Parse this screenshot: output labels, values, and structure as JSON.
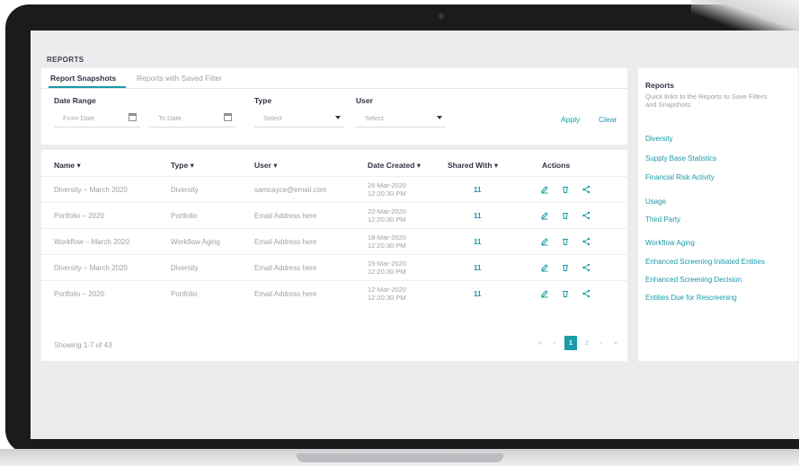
{
  "section_title": "REPORTS",
  "tabs": [
    {
      "label": "Report Snapshots",
      "active": true
    },
    {
      "label": "Reports with Saved Filter",
      "active": false
    }
  ],
  "filters": {
    "date_range_label": "Date Range",
    "from_date_placeholder": "From Date",
    "to_date_placeholder": "To Date",
    "type_label": "Type",
    "type_value": "Select",
    "user_label": "User",
    "user_value": "Select",
    "apply_label": "Apply",
    "clear_label": "Clear"
  },
  "table": {
    "headers": {
      "name": "Name ▾",
      "type": "Type ▾",
      "user": "User ▾",
      "date_created": "Date Created ▾",
      "shared_with": "Shared With ▾",
      "actions": "Actions"
    },
    "rows": [
      {
        "name": "Diversity – March 2020",
        "type": "Diversity",
        "user": "samcayce@email.com",
        "date": "26-Mar-2020",
        "time": "12:20:30 PM",
        "shared": "11"
      },
      {
        "name": "Portfolio – 2020",
        "type": "Portfolio",
        "user": "Email Address here",
        "date": "22-Mar-2020",
        "time": "12:20:30 PM",
        "shared": "11"
      },
      {
        "name": "Workflow – March 2020",
        "type": "Workflow Aging",
        "user": "Email Address here",
        "date": "18-Mar-2020",
        "time": "12:20:30 PM",
        "shared": "11"
      },
      {
        "name": "Diversity – March 2020",
        "type": "Diversity",
        "user": "Email Address here",
        "date": "15-Mar-2020",
        "time": "12:20:30 PM",
        "shared": "11"
      },
      {
        "name": "Portfolio – 2020",
        "type": "Portfolio",
        "user": "Email Address here",
        "date": "12-Mar-2020",
        "time": "12:20:30 PM",
        "shared": "11"
      }
    ],
    "row_actions": [
      "edit-icon",
      "delete-icon",
      "share-icon"
    ]
  },
  "footer": {
    "showing": "Showing 1-7 of 43",
    "pagination": {
      "first": "«",
      "prev": "‹",
      "pages": [
        "1",
        "2"
      ],
      "current": "1",
      "next": "›",
      "last": "»"
    }
  },
  "sidebar": {
    "title": "Reports",
    "description": "Quick links to the Reports to Save Filters and Snapshots",
    "links": [
      "Diversity",
      "Supply Base Statistics",
      "Financial Risk Activity",
      "Usage",
      "Third Party",
      "Workflow Aging",
      "Enhanced Screening Initiated Entities",
      "Enhanced Screening Decision",
      "Entities Due for Rescreening"
    ]
  },
  "colors": {
    "accent": "#1b9aa8",
    "bezel": "#1b1b1d",
    "screen_bg": "#ececee",
    "text_dark": "#2f3440",
    "text_muted": "#9ca1a8"
  }
}
